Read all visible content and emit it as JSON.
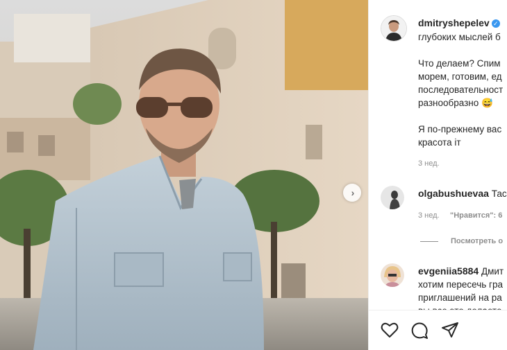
{
  "post": {
    "author": "dmitryshepelev",
    "caption_lines": [
      "глубоких мыслей б",
      "",
      "Что делаем? Спим",
      "морем, готовим, ед",
      "последовательност",
      "разнообразно 😅",
      "",
      "Я по-прежнему вас",
      "красота іт"
    ],
    "caption_first_line_tail": "",
    "time": "3 нед."
  },
  "comments": [
    {
      "user": "olgabushuevaa",
      "text": "Тас",
      "time": "3 нед.",
      "likes_label": "\"Нравится\": 6"
    },
    {
      "user": "evgeniia5884",
      "text_first": "Дмит",
      "text_lines": [
        "хотим пересечь гра",
        "приглашений на ра",
        "вы все это делаете"
      ]
    }
  ],
  "view_replies": "Посмотреть о",
  "icons": {
    "like": "heart-icon",
    "comment": "comment-icon",
    "share": "paper-plane-icon",
    "next": "chevron-right-icon",
    "verified": "verified-badge-icon"
  },
  "colors": {
    "verified": "#3897f0",
    "text": "#262626",
    "muted": "#8e8e8e"
  }
}
